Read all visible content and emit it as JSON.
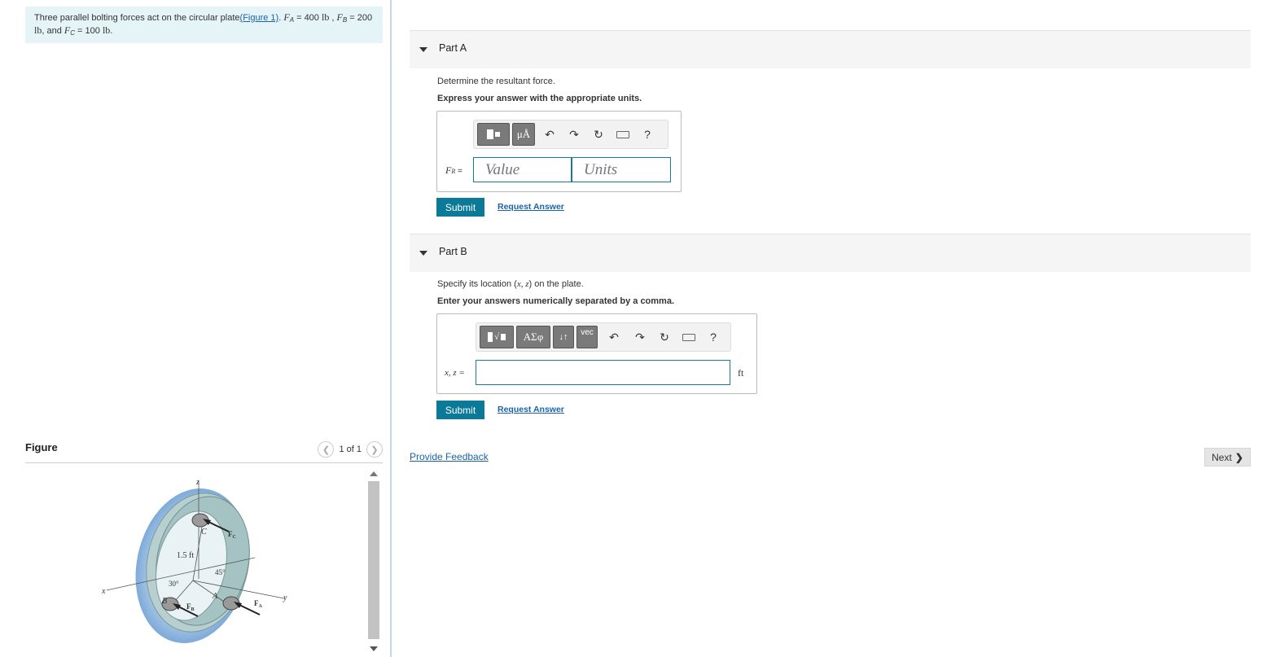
{
  "problem": {
    "text1": "Three parallel bolting forces act on the circular plate",
    "figure_link": "(Figure 1)",
    "FA_var": "F",
    "FA_sub": "A",
    "FA_val": " = 400 ",
    "FB_var": "F",
    "FB_sub": "B",
    "FB_val": " = 200",
    "unit_lb": "lb",
    "and_text": ", and ",
    "FC_var": "F",
    "FC_sub": "C",
    "FC_val": " = 100 ",
    "end": "."
  },
  "figure": {
    "title": "Figure",
    "pager_text": "1 of 1",
    "labels": {
      "z": "z",
      "x": "x",
      "y": "y",
      "C": "C",
      "B": "B",
      "A": "A",
      "dist": "1.5 ft",
      "ang30": "30°",
      "ang45": "45°",
      "FC": "F",
      "FC_sub": "C",
      "FB": "F",
      "FB_sub": "B",
      "FA": "F",
      "FA_sub": "A"
    }
  },
  "partA": {
    "title": "Part A",
    "question": "Determine the resultant force.",
    "instruction": "Express your answer with the appropriate units.",
    "toolbar": {
      "mu_label": "μÅ",
      "help": "?"
    },
    "label_var": "F",
    "label_sub": "R",
    "label_eq": " =",
    "value_placeholder": "Value",
    "units_placeholder": "Units",
    "submit": "Submit",
    "request": "Request Answer"
  },
  "partB": {
    "title": "Part B",
    "question_pre": "Specify its location (",
    "question_vars": "x, z",
    "question_post": ") on the plate.",
    "instruction": "Enter your answers numerically separated by a comma.",
    "toolbar": {
      "greek": "ΑΣφ",
      "arrows": "↓↑",
      "vec": "vec",
      "help": "?"
    },
    "label": "x, z =",
    "unit": "ft",
    "submit": "Submit",
    "request": "Request Answer"
  },
  "footer": {
    "feedback": "Provide Feedback",
    "next": "Next"
  }
}
